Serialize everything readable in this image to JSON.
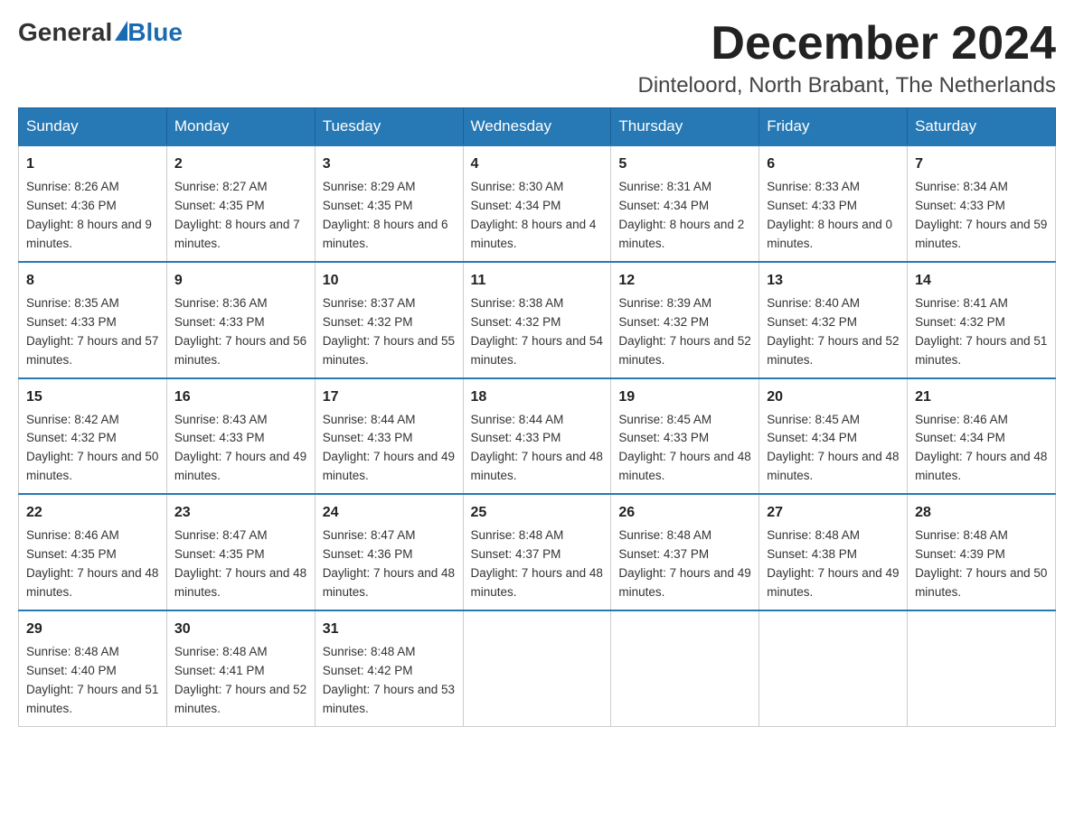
{
  "logo": {
    "general": "General",
    "blue": "Blue"
  },
  "title": {
    "month": "December 2024",
    "location": "Dinteloord, North Brabant, The Netherlands"
  },
  "weekdays": [
    "Sunday",
    "Monday",
    "Tuesday",
    "Wednesday",
    "Thursday",
    "Friday",
    "Saturday"
  ],
  "weeks": [
    [
      {
        "day": "1",
        "sunrise": "8:26 AM",
        "sunset": "4:36 PM",
        "daylight": "8 hours and 9 minutes."
      },
      {
        "day": "2",
        "sunrise": "8:27 AM",
        "sunset": "4:35 PM",
        "daylight": "8 hours and 7 minutes."
      },
      {
        "day": "3",
        "sunrise": "8:29 AM",
        "sunset": "4:35 PM",
        "daylight": "8 hours and 6 minutes."
      },
      {
        "day": "4",
        "sunrise": "8:30 AM",
        "sunset": "4:34 PM",
        "daylight": "8 hours and 4 minutes."
      },
      {
        "day": "5",
        "sunrise": "8:31 AM",
        "sunset": "4:34 PM",
        "daylight": "8 hours and 2 minutes."
      },
      {
        "day": "6",
        "sunrise": "8:33 AM",
        "sunset": "4:33 PM",
        "daylight": "8 hours and 0 minutes."
      },
      {
        "day": "7",
        "sunrise": "8:34 AM",
        "sunset": "4:33 PM",
        "daylight": "7 hours and 59 minutes."
      }
    ],
    [
      {
        "day": "8",
        "sunrise": "8:35 AM",
        "sunset": "4:33 PM",
        "daylight": "7 hours and 57 minutes."
      },
      {
        "day": "9",
        "sunrise": "8:36 AM",
        "sunset": "4:33 PM",
        "daylight": "7 hours and 56 minutes."
      },
      {
        "day": "10",
        "sunrise": "8:37 AM",
        "sunset": "4:32 PM",
        "daylight": "7 hours and 55 minutes."
      },
      {
        "day": "11",
        "sunrise": "8:38 AM",
        "sunset": "4:32 PM",
        "daylight": "7 hours and 54 minutes."
      },
      {
        "day": "12",
        "sunrise": "8:39 AM",
        "sunset": "4:32 PM",
        "daylight": "7 hours and 52 minutes."
      },
      {
        "day": "13",
        "sunrise": "8:40 AM",
        "sunset": "4:32 PM",
        "daylight": "7 hours and 52 minutes."
      },
      {
        "day": "14",
        "sunrise": "8:41 AM",
        "sunset": "4:32 PM",
        "daylight": "7 hours and 51 minutes."
      }
    ],
    [
      {
        "day": "15",
        "sunrise": "8:42 AM",
        "sunset": "4:32 PM",
        "daylight": "7 hours and 50 minutes."
      },
      {
        "day": "16",
        "sunrise": "8:43 AM",
        "sunset": "4:33 PM",
        "daylight": "7 hours and 49 minutes."
      },
      {
        "day": "17",
        "sunrise": "8:44 AM",
        "sunset": "4:33 PM",
        "daylight": "7 hours and 49 minutes."
      },
      {
        "day": "18",
        "sunrise": "8:44 AM",
        "sunset": "4:33 PM",
        "daylight": "7 hours and 48 minutes."
      },
      {
        "day": "19",
        "sunrise": "8:45 AM",
        "sunset": "4:33 PM",
        "daylight": "7 hours and 48 minutes."
      },
      {
        "day": "20",
        "sunrise": "8:45 AM",
        "sunset": "4:34 PM",
        "daylight": "7 hours and 48 minutes."
      },
      {
        "day": "21",
        "sunrise": "8:46 AM",
        "sunset": "4:34 PM",
        "daylight": "7 hours and 48 minutes."
      }
    ],
    [
      {
        "day": "22",
        "sunrise": "8:46 AM",
        "sunset": "4:35 PM",
        "daylight": "7 hours and 48 minutes."
      },
      {
        "day": "23",
        "sunrise": "8:47 AM",
        "sunset": "4:35 PM",
        "daylight": "7 hours and 48 minutes."
      },
      {
        "day": "24",
        "sunrise": "8:47 AM",
        "sunset": "4:36 PM",
        "daylight": "7 hours and 48 minutes."
      },
      {
        "day": "25",
        "sunrise": "8:48 AM",
        "sunset": "4:37 PM",
        "daylight": "7 hours and 48 minutes."
      },
      {
        "day": "26",
        "sunrise": "8:48 AM",
        "sunset": "4:37 PM",
        "daylight": "7 hours and 49 minutes."
      },
      {
        "day": "27",
        "sunrise": "8:48 AM",
        "sunset": "4:38 PM",
        "daylight": "7 hours and 49 minutes."
      },
      {
        "day": "28",
        "sunrise": "8:48 AM",
        "sunset": "4:39 PM",
        "daylight": "7 hours and 50 minutes."
      }
    ],
    [
      {
        "day": "29",
        "sunrise": "8:48 AM",
        "sunset": "4:40 PM",
        "daylight": "7 hours and 51 minutes."
      },
      {
        "day": "30",
        "sunrise": "8:48 AM",
        "sunset": "4:41 PM",
        "daylight": "7 hours and 52 minutes."
      },
      {
        "day": "31",
        "sunrise": "8:48 AM",
        "sunset": "4:42 PM",
        "daylight": "7 hours and 53 minutes."
      },
      null,
      null,
      null,
      null
    ]
  ]
}
